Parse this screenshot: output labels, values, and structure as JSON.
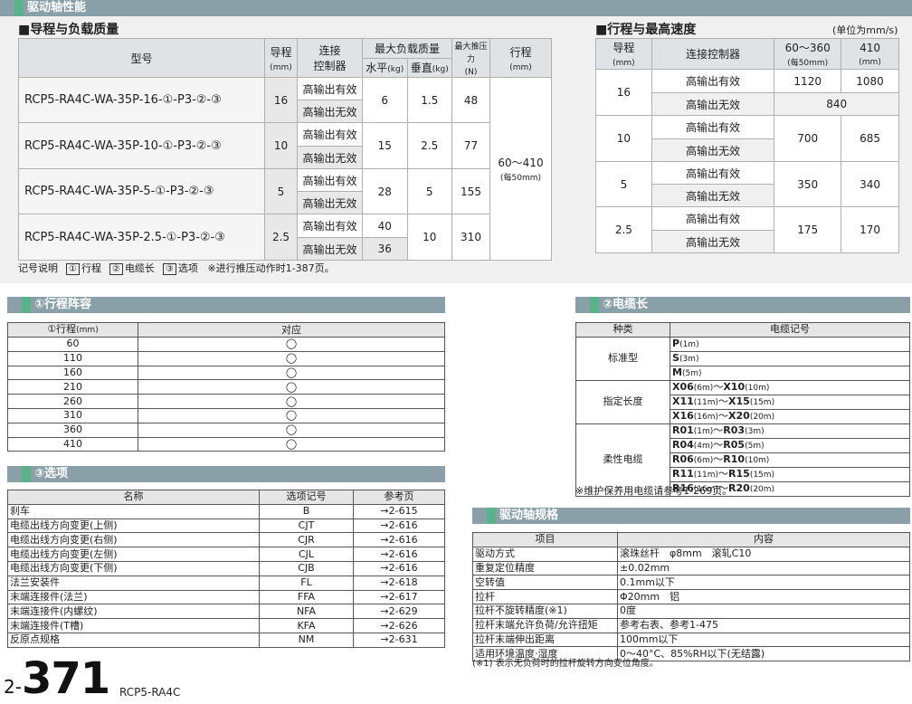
{
  "header": {
    "section_title": "驱动轴性能"
  },
  "table1": {
    "title": "■导程与负载质量",
    "headers": {
      "model": "型号",
      "lead": "导程",
      "lead_unit": "(mm)",
      "ctl_1": "连接",
      "ctl_2": "控制器",
      "maxload": "最大负载质量",
      "horiz": "水平",
      "vert": "垂直",
      "kg": "(kg)",
      "push": "最大推压力",
      "push_unit": "(N)",
      "stroke": "行程",
      "stroke_unit": "(mm)"
    },
    "rows": [
      {
        "model": "RCP5-RA4C-WA-35P-16-①-P3-②-③",
        "lead": "16",
        "ctl_on": "高输出有效",
        "ctl_off": "高输出无效",
        "h_on": "6",
        "h_off": "",
        "vert": "1.5",
        "push": "48"
      },
      {
        "model": "RCP5-RA4C-WA-35P-10-①-P3-②-③",
        "lead": "10",
        "ctl_on": "高输出有效",
        "ctl_off": "高输出无效",
        "h_on": "15",
        "h_off": "",
        "vert": "2.5",
        "push": "77"
      },
      {
        "model": "RCP5-RA4C-WA-35P-5-①-P3-②-③",
        "lead": "5",
        "ctl_on": "高输出有效",
        "ctl_off": "高输出无效",
        "h_on": "28",
        "h_off": "",
        "vert": "5",
        "push": "155"
      },
      {
        "model": "RCP5-RA4C-WA-35P-2.5-①-P3-②-③",
        "lead": "2.5",
        "ctl_on": "高输出有效",
        "ctl_off": "高输出无效",
        "h_on": "40",
        "h_off": "36",
        "vert": "10",
        "push": "310"
      }
    ],
    "stroke_value": "60～410",
    "stroke_note": "(每50mm)"
  },
  "table2": {
    "title": "■行程与最高速度",
    "unit": "(单位为mm/s)",
    "headers": {
      "lead": "导程",
      "lead_unit": "(mm)",
      "ctl": "连接控制器",
      "col1": "60～360",
      "col1_sub": "(每50mm)",
      "col2": "410",
      "col2_sub": "(mm)"
    },
    "rows": [
      {
        "lead": "16",
        "ctl_on": "高输出有效",
        "ctl_off": "高输出无效",
        "on_1": "1120",
        "on_2": "1080",
        "off": "840"
      },
      {
        "lead": "10",
        "ctl_on": "高输出有效",
        "ctl_off": "高输出无效",
        "v1": "700",
        "v2": "685"
      },
      {
        "lead": "5",
        "ctl_on": "高输出有效",
        "ctl_off": "高输出无效",
        "v1": "350",
        "v2": "340"
      },
      {
        "lead": "2.5",
        "ctl_on": "高输出有效",
        "ctl_off": "高输出无效",
        "v1": "175",
        "v2": "170"
      }
    ]
  },
  "legend": {
    "prefix": "记号说明",
    "b1": "①",
    "l1": "行程",
    "b2": "②",
    "l2": "电缆长",
    "b3": "③",
    "l3": "选项",
    "note": "※进行推压动作时1-387页。"
  },
  "stroke_list": {
    "title": "①行程阵容",
    "head1": "①行程",
    "head1_unit": "(mm)",
    "head2": "对应",
    "rows": [
      {
        "stroke": "60",
        "mark": "◯"
      },
      {
        "stroke": "110",
        "mark": "◯"
      },
      {
        "stroke": "160",
        "mark": "◯"
      },
      {
        "stroke": "210",
        "mark": "◯"
      },
      {
        "stroke": "260",
        "mark": "◯"
      },
      {
        "stroke": "310",
        "mark": "◯"
      },
      {
        "stroke": "360",
        "mark": "◯"
      },
      {
        "stroke": "410",
        "mark": "◯"
      }
    ]
  },
  "options": {
    "title": "③选项",
    "headers": [
      "名称",
      "选项记号",
      "参考页"
    ],
    "rows": [
      {
        "name": "刹车",
        "code": "B",
        "page": "→2-615"
      },
      {
        "name": "电缆出线方向变更(上侧)",
        "code": "CJT",
        "page": "→2-616"
      },
      {
        "name": "电缆出线方向变更(右侧)",
        "code": "CJR",
        "page": "→2-616"
      },
      {
        "name": "电缆出线方向变更(左侧)",
        "code": "CJL",
        "page": "→2-616"
      },
      {
        "name": "电缆出线方向变更(下侧)",
        "code": "CJB",
        "page": "→2-616"
      },
      {
        "name": "法兰安装件",
        "code": "FL",
        "page": "→2-618"
      },
      {
        "name": "末端连接件(法兰)",
        "code": "FFA",
        "page": "→2-617"
      },
      {
        "name": "末端连接件(内螺纹)",
        "code": "NFA",
        "page": "→2-629"
      },
      {
        "name": "末端连接件(T槽)",
        "code": "KFA",
        "page": "→2-626"
      },
      {
        "name": "反原点规格",
        "code": "NM",
        "page": "→2-631"
      }
    ]
  },
  "cable": {
    "title": "②电缆长",
    "headers": [
      "种类",
      "电缆记号"
    ],
    "groups": [
      {
        "type": "标准型",
        "items": [
          {
            "code": "P",
            "len": "(1m)"
          },
          {
            "code": "S",
            "len": "(3m)"
          },
          {
            "code": "M",
            "len": "(5m)"
          }
        ]
      },
      {
        "type": "指定长度",
        "items": [
          {
            "code": "X06",
            "len": "(6m)",
            "sep": "～",
            "code2": "X10",
            "len2": "(10m)"
          },
          {
            "code": "X11",
            "len": "(11m)",
            "sep": "～",
            "code2": "X15",
            "len2": "(15m)"
          },
          {
            "code": "X16",
            "len": "(16m)",
            "sep": "～",
            "code2": "X20",
            "len2": "(20m)"
          }
        ]
      },
      {
        "type": "柔性电缆",
        "items": [
          {
            "code": "R01",
            "len": "(1m)",
            "sep": "～",
            "code2": "R03",
            "len2": "(3m)"
          },
          {
            "code": "R04",
            "len": "(4m)",
            "sep": "～",
            "code2": "R05",
            "len2": "(5m)"
          },
          {
            "code": "R06",
            "len": "(6m)",
            "sep": "～",
            "code2": "R10",
            "len2": "(10m)"
          },
          {
            "code": "R11",
            "len": "(11m)",
            "sep": "～",
            "code2": "R15",
            "len2": "(15m)"
          },
          {
            "code": "R16",
            "len": "(16m)",
            "sep": "～",
            "code2": "R20",
            "len2": "(20m)"
          }
        ]
      }
    ],
    "note": "※维护保养用电缆请参考1-269页。"
  },
  "spec": {
    "title": "驱动轴规格",
    "headers": [
      "项目",
      "内容"
    ],
    "rows": [
      {
        "item": "驱动方式",
        "value": "滚珠丝杆　φ8mm　滚轧C10"
      },
      {
        "item": "重复定位精度",
        "value": "±0.02mm"
      },
      {
        "item": "空转值",
        "value": "0.1mm以下"
      },
      {
        "item": "拉杆",
        "value": "Φ20mm　铝"
      },
      {
        "item": "拉杆不旋转精度(※1)",
        "value": "0度"
      },
      {
        "item": "拉杆末端允许负荷/允许扭矩",
        "value": "参考右表、参考1-475"
      },
      {
        "item": "拉杆末端伸出距离",
        "value": "100mm以下"
      },
      {
        "item": "适用环境温度·湿度",
        "value": "0～40°C、85%RH以下(无结露)"
      }
    ],
    "note": "(※1) 表示无负荷时的拉杆旋转方向变位角度。"
  },
  "footer": {
    "page_prefix": "2-",
    "page_num": "371",
    "model": "RCP5-RA4C"
  }
}
